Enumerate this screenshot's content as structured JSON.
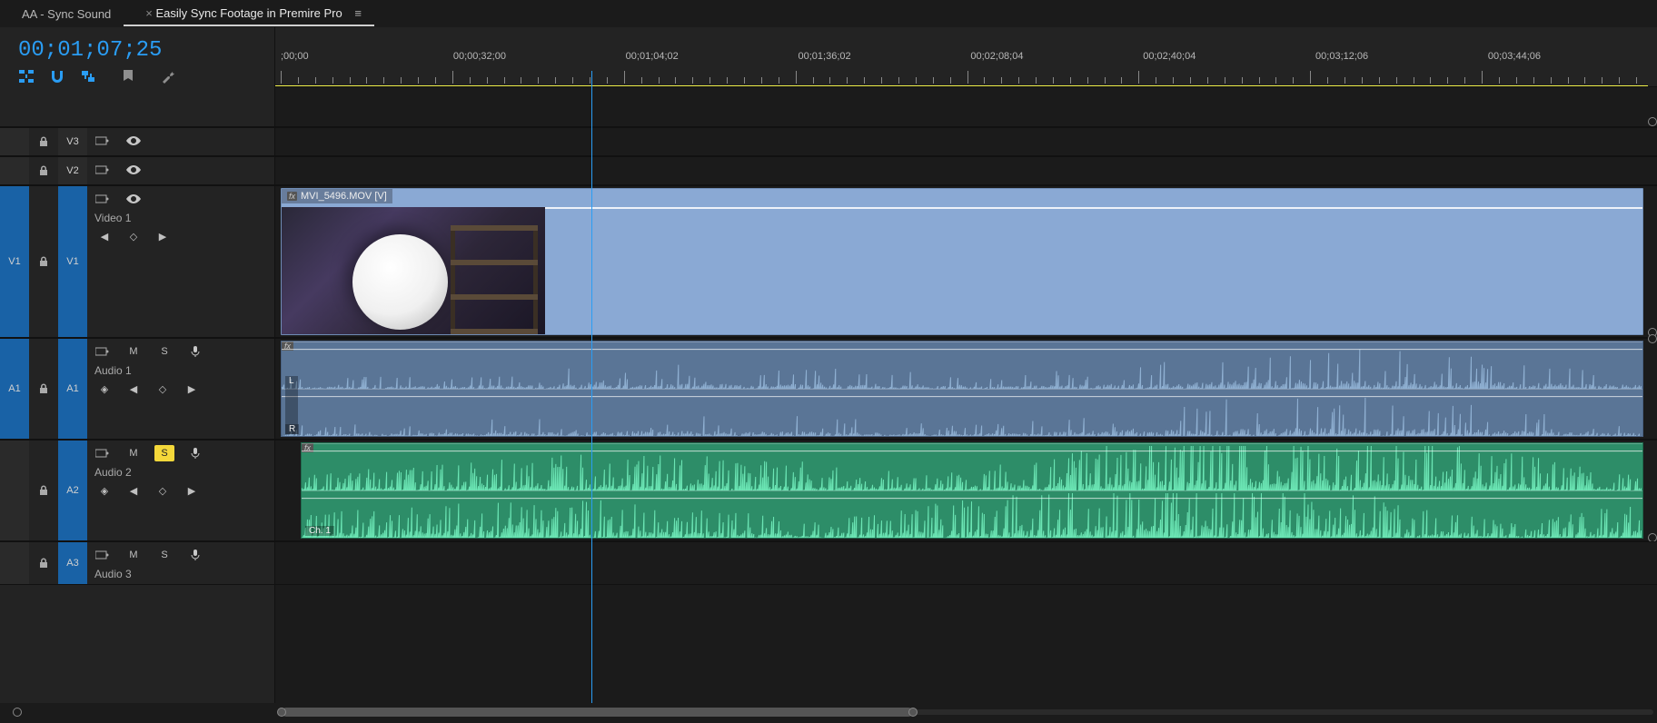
{
  "tabs": [
    {
      "label": "AA - Sync Sound",
      "active": false
    },
    {
      "label": "Easily Sync Footage in Premire Pro",
      "active": true
    }
  ],
  "timecode": "00;01;07;25",
  "ruler_marks": [
    ";00;00",
    "00;00;32;00",
    "00;01;04;02",
    "00;01;36;02",
    "00;02;08;04",
    "00;02;40;04",
    "00;03;12;06",
    "00;03;44;06"
  ],
  "tracks": {
    "v3": {
      "id": "V3"
    },
    "v2": {
      "id": "V2"
    },
    "v1": {
      "src": "V1",
      "tgt": "V1",
      "label": "Video 1"
    },
    "a1": {
      "src": "A1",
      "tgt": "A1",
      "label": "Audio 1",
      "chan_l": "L",
      "chan_r": "R"
    },
    "a2": {
      "tgt": "A2",
      "label": "Audio 2",
      "chan": "Ch. 1"
    },
    "a3": {
      "tgt": "A3",
      "label": "Audio 3"
    }
  },
  "track_buttons": {
    "mute": "M",
    "solo": "S"
  },
  "clips": {
    "video": {
      "title": "MVI_5496.MOV [V]"
    }
  },
  "colors": {
    "accent": "#2a9df4",
    "audio1": "#5a7596",
    "audio2": "#2d8d68",
    "video": "#8aa9d4",
    "solo_on": "#f4d83a"
  }
}
